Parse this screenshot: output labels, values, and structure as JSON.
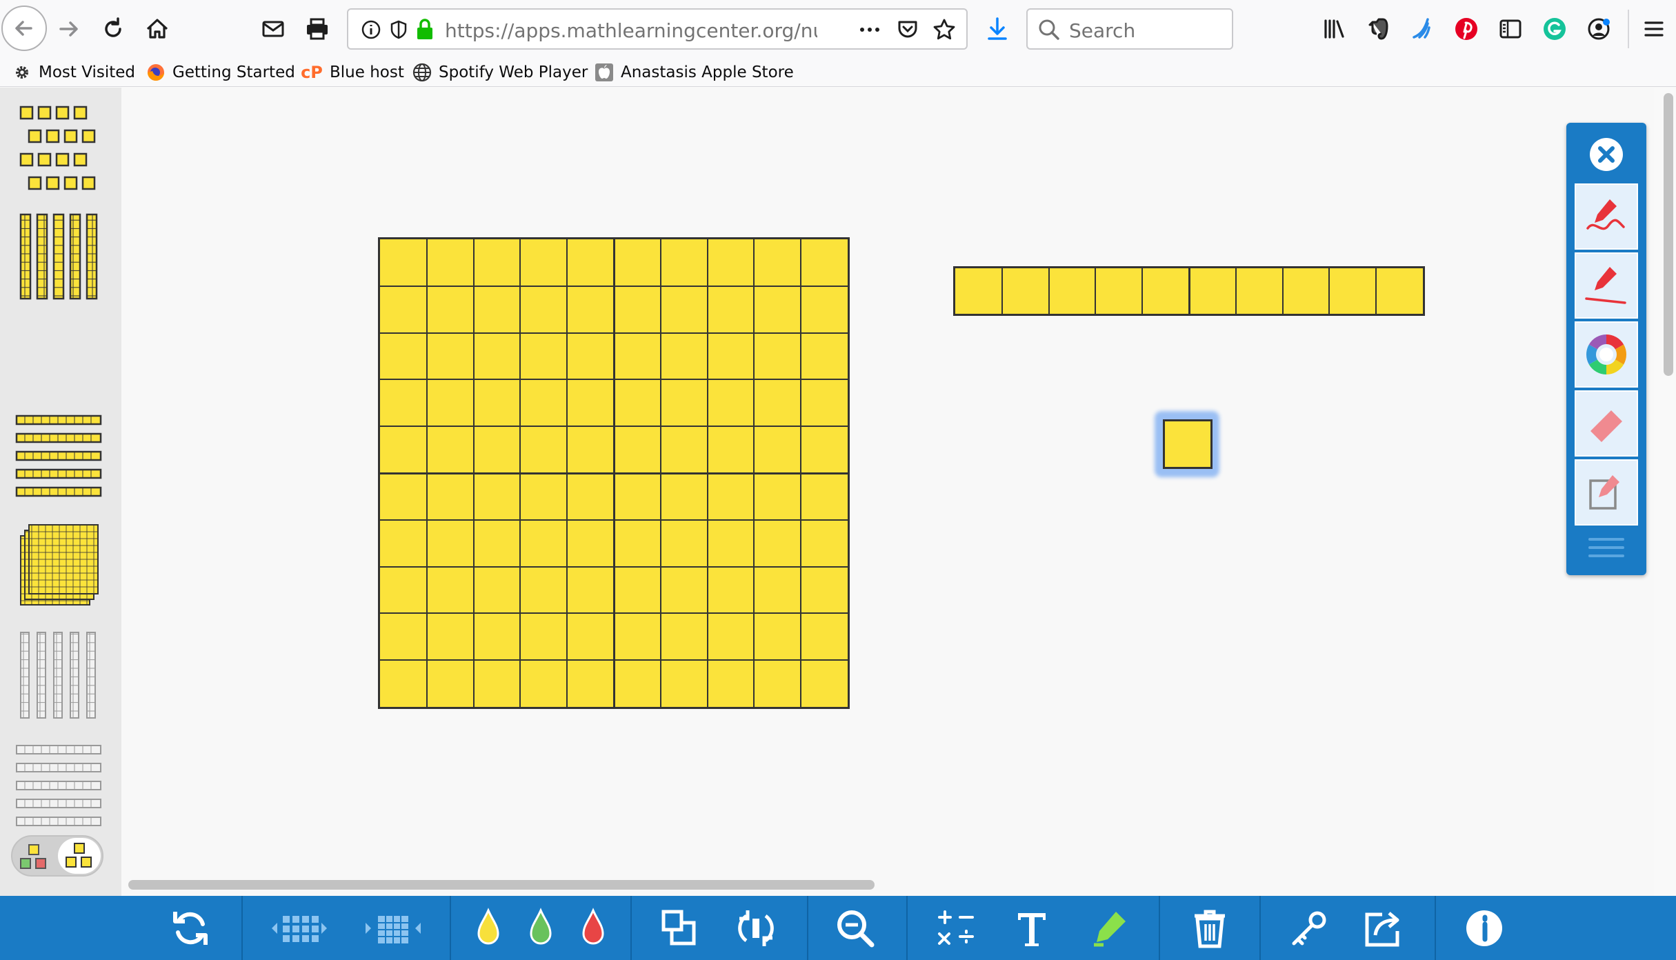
{
  "browser": {
    "url_display": "https://apps.mathlearningcenter.org/num",
    "search_placeholder": "Search",
    "bookmarks": [
      {
        "label": "Most Visited",
        "icon": "gear-icon"
      },
      {
        "label": "Getting Started",
        "icon": "firefox-icon"
      },
      {
        "label": "Blue host",
        "icon": "cpanel-icon"
      },
      {
        "label": "Spotify Web Player",
        "icon": "globe-icon"
      },
      {
        "label": "Anastasis Apple Store",
        "icon": "apple-icon"
      }
    ]
  },
  "app": {
    "palette_items": [
      "units-tray",
      "rods-vertical-tray",
      "rods-horizontal-tray",
      "flats-tray",
      "outline-rods-vertical-tray",
      "outline-rods-horizontal-tray"
    ],
    "mode_toggle": [
      "colored-pieces-mode",
      "yellow-pieces-mode"
    ],
    "canvas_pieces": [
      {
        "type": "flat",
        "rows": 10,
        "cols": 10
      },
      {
        "type": "rod",
        "rows": 1,
        "cols": 10
      },
      {
        "type": "unit",
        "rows": 1,
        "cols": 1,
        "selected": true
      }
    ],
    "colors": {
      "piece_fill": "#fbe33b",
      "toolbar_blue": "#1a7bc5",
      "selection_glow": "#4d8ff0"
    },
    "right_panel_tools": [
      "close-icon",
      "freehand-pen-icon",
      "line-pen-icon",
      "color-wheel-icon",
      "eraser-icon",
      "clear-drawing-icon",
      "drag-handle-icon"
    ],
    "bottom_tools": [
      "refresh-icon",
      "group-units-icon",
      "ungroup-units-icon",
      "yellow-drop-icon",
      "green-drop-icon",
      "red-drop-icon",
      "duplicate-icon",
      "rotate-icon",
      "zoom-out-icon",
      "math-symbols-icon",
      "text-icon",
      "highlighter-icon",
      "trash-icon",
      "key-icon",
      "share-icon",
      "info-icon"
    ]
  }
}
